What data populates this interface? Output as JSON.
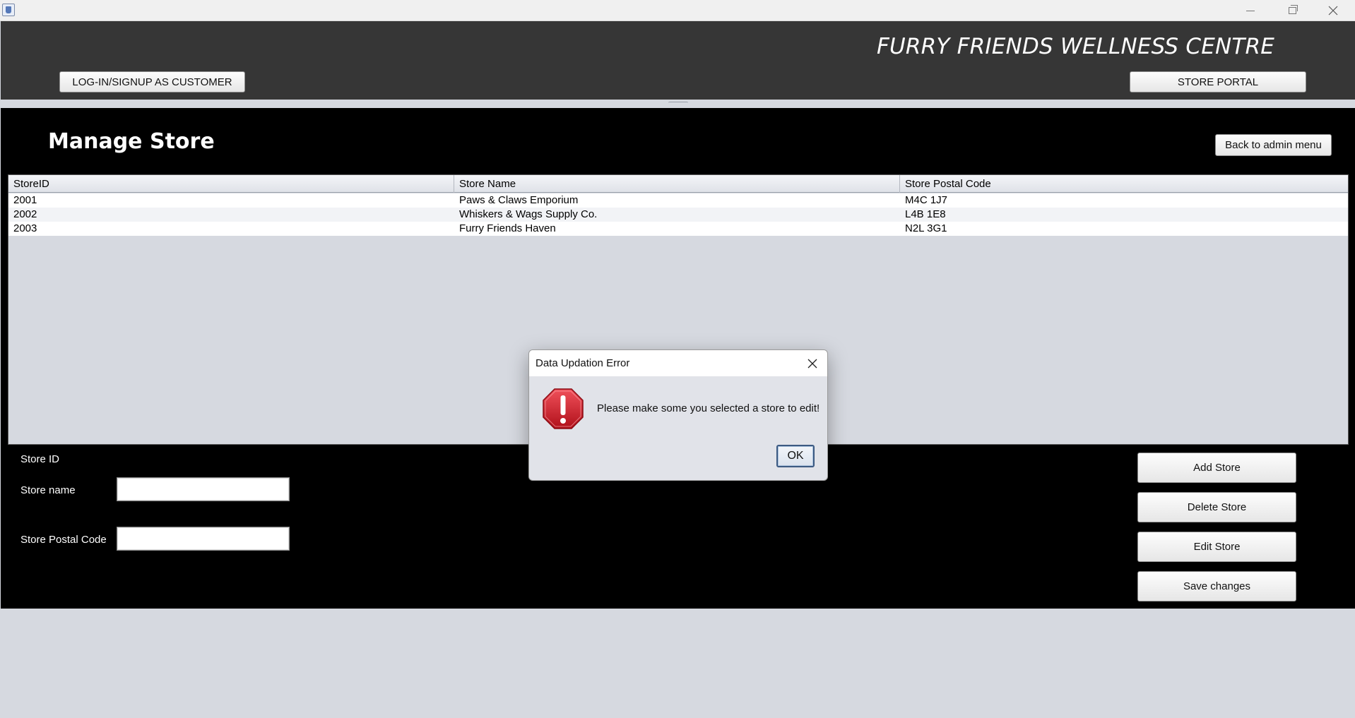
{
  "window": {
    "title": "",
    "icons": {
      "app": "java-cup-icon",
      "minimize": "minimize-icon",
      "maximize": "restore-icon",
      "close": "close-icon"
    }
  },
  "header": {
    "brand": "FURRY FRIENDS WELLNESS CENTRE",
    "login_label": "LOG-IN/SIGNUP AS CUSTOMER",
    "portal_label": "STORE PORTAL"
  },
  "main": {
    "title": "Manage Store",
    "back_label": "Back to admin menu"
  },
  "table": {
    "columns": [
      "StoreID",
      "Store Name",
      "Store Postal Code"
    ],
    "rows": [
      [
        "2001",
        "Paws & Claws Emporium",
        "M4C 1J7"
      ],
      [
        "2002",
        "Whiskers & Wags Supply Co.",
        "L4B 1E8"
      ],
      [
        "2003",
        "Furry Friends Haven",
        "N2L 3G1"
      ]
    ]
  },
  "form": {
    "store_id_label": "Store ID",
    "store_name_label": "Store name",
    "store_name_value": "",
    "postal_label": "Store Postal Code",
    "postal_value": ""
  },
  "actions": {
    "add": "Add Store",
    "delete": "Delete Store",
    "edit": "Edit Store",
    "save": "Save changes"
  },
  "dialog": {
    "title": "Data Updation Error",
    "message": "Please make some you selected a store to edit!",
    "ok_label": "OK",
    "icon": "error-icon"
  },
  "colors": {
    "header_bg": "#363636",
    "main_bg": "#000000",
    "surface": "#d6d9e0",
    "error_red": "#d0202a"
  }
}
